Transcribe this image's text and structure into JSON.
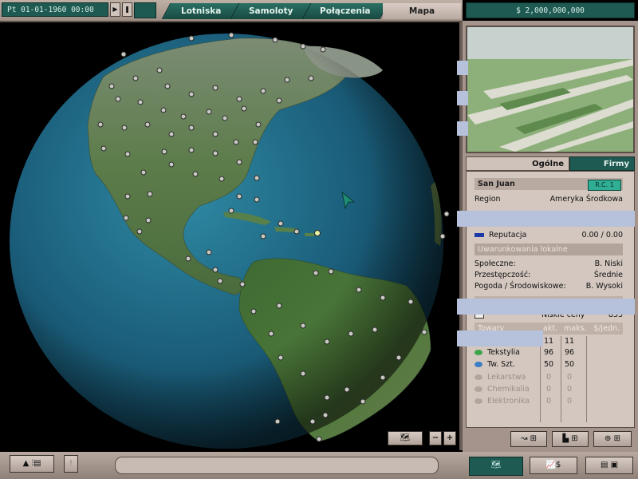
{
  "header": {
    "date": "Pt 01-01-1960 00:00",
    "money": "$ 2,000,000,000",
    "tabs": [
      "Lotniska",
      "Samoloty",
      "Połączenia"
    ],
    "active_tab": "Mapa"
  },
  "info_tabs": {
    "general": "Ogólne",
    "companies": "Firmy"
  },
  "airport": {
    "name": "San Juan",
    "badge": "R.C. 1",
    "region_label": "Region",
    "region_value": "Ameryka Środkowa",
    "reputation_label": "Reputacja",
    "reputation_value": "0.00 / 0.00",
    "local_conditions_label": "Uwarunkowania lokalne",
    "conditions": [
      {
        "label": "Społeczne:",
        "value": "B. Niski"
      },
      {
        "label": "Przestępczość:",
        "value": "Średnie"
      },
      {
        "label": "Pogoda / Środowiskowe:",
        "value": "B. Wysoki"
      }
    ],
    "low_prices_label": "Niskie ceny",
    "low_prices_value": "833",
    "goods_header": {
      "name": "Towary",
      "act": "akt.",
      "max": "maks.",
      "per_unit": "$/jedn."
    },
    "goods": [
      {
        "name": "",
        "act": "11",
        "max": "11",
        "color": "#3aa54a",
        "enabled": true
      },
      {
        "name": "Tekstylia",
        "act": "96",
        "max": "96",
        "color": "#3aa54a",
        "enabled": true
      },
      {
        "name": "Tw. Szt.",
        "act": "50",
        "max": "50",
        "color": "#3a7fc6",
        "enabled": true
      },
      {
        "name": "Lekarstwa",
        "act": "0",
        "max": "0",
        "color": "#a99b92",
        "enabled": false
      },
      {
        "name": "Chemikalia",
        "act": "0",
        "max": "0",
        "color": "#a99b92",
        "enabled": false
      },
      {
        "name": "Elektronika",
        "act": "0",
        "max": "0",
        "color": "#a99b92",
        "enabled": false
      }
    ]
  },
  "map_controls": {
    "zoom_out": "−",
    "zoom_in": "+"
  },
  "icons": {
    "speed": "speed-control-icon",
    "world": "world-map-icon",
    "stats": "statistics-icon",
    "list": "list-icon",
    "routes": "route-icon",
    "city": "city-icon",
    "search": "magnify-icon"
  },
  "colors": {
    "accent": "#1e5a52",
    "panel": "#d3c7bf",
    "ocean": "#1c6785",
    "land": "#4f7a3f"
  }
}
